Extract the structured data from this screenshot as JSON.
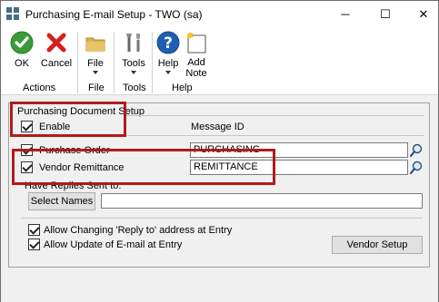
{
  "window": {
    "title": "Purchasing E-mail Setup  -  TWO (sa)",
    "minimize_glyph": "─",
    "maximize_glyph": "☐",
    "close_glyph": "✕"
  },
  "ribbon": {
    "ok_label": "OK",
    "cancel_label": "Cancel",
    "file_label": "File",
    "tools_label": "Tools",
    "help_label": "Help",
    "add_note_label_1": "Add",
    "add_note_label_2": "Note",
    "groups": {
      "actions": "Actions",
      "file": "File",
      "tools": "Tools",
      "help": "Help"
    }
  },
  "form": {
    "section_title": "Purchasing Document Setup",
    "enable_label": "Enable",
    "message_id_header": "Message ID",
    "purchase_order_label": "Purchase Order",
    "purchase_order_value": "PURCHASING",
    "vendor_remittance_label": "Vendor Remittance",
    "vendor_remittance_value": "REMITTANCE",
    "have_replies_label": "Have Replies Sent to:",
    "select_names_label": "Select Names",
    "select_names_value": "",
    "allow_reply_label": "Allow Changing 'Reply to' address at Entry",
    "allow_update_label": "Allow Update of E-mail at Entry",
    "vendor_setup_label": "Vendor Setup"
  },
  "colors": {
    "highlight": "#b01b1b",
    "ok_green": "#3a9b3a",
    "cancel_red": "#d42020",
    "help_blue": "#1e5fb4"
  }
}
